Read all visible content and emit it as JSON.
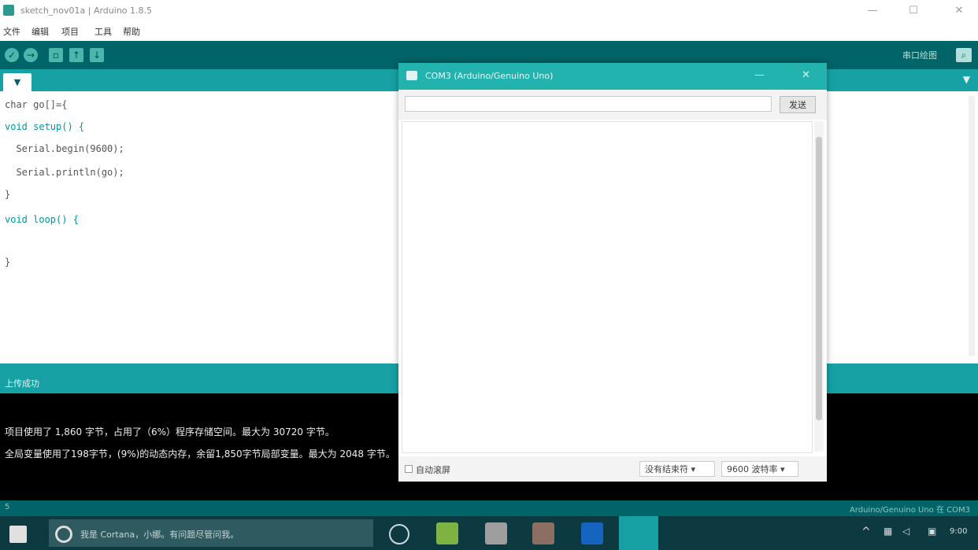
{
  "window": {
    "title": "sketch_nov01a | Arduino 1.8.5",
    "minimize": "—",
    "maximize": "☐",
    "close": "✕"
  },
  "menu": [
    "文件",
    "编辑",
    "项目",
    "工具",
    "帮助"
  ],
  "toolbar": {
    "verify": "✓",
    "upload": "→",
    "new": "▫",
    "open": "↑",
    "save": "↓",
    "serial_plotter": "串口绘图",
    "serial_monitor": "⌕"
  },
  "tab": {
    "name": "▼",
    "menu": "▼"
  },
  "code": [
    "char go[]={",
    "void setup() {",
    "  Serial.begin(9600);",
    "  Serial.println(go);",
    "}",
    "void loop() {",
    "",
    "}"
  ],
  "console": {
    "header": "上传成功",
    "lines": [
      "项目使用了 1,860 字节，占用了（6%）程序存储空间。最大为 30720 字节。",
      "全局变量使用了198字节，(9%)的动态内存，余留1,850字节局部变量。最大为 2048 字节。"
    ],
    "footer_line": "5",
    "footer_board": "Arduino/Genuino Uno 在 COM3"
  },
  "serial_monitor": {
    "title": "COM3 (Arduino/Genuino Uno)",
    "minimize": "—",
    "close": "✕",
    "send_input_value": "",
    "send_label": "发送",
    "output": "",
    "autoscroll_label": "自动滚屏",
    "line_ending": "没有结束符 ▾",
    "baud": "9600 波特率 ▾"
  },
  "taskbar": {
    "search_placeholder": "我是 Cortana，小娜。有问题尽管问我。",
    "time": "9:00"
  },
  "colors": {
    "toolbar": "#006468",
    "tabstrip": "#17a1a5",
    "monitor_title": "#23b3ae",
    "console_bg": "#000000",
    "taskbar": "#0c3a40"
  }
}
